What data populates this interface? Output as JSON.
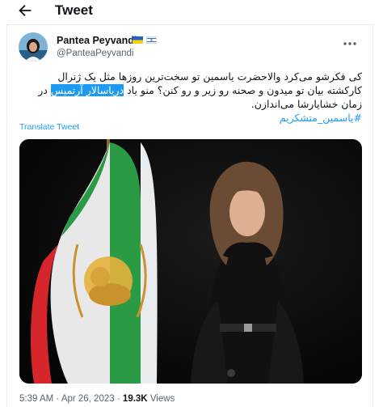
{
  "header": {
    "back_icon": "arrow-left-icon",
    "title": "Tweet"
  },
  "tweet": {
    "author": {
      "display_name": "Pantea Peyvandi",
      "handle": "@PanteaPeyvandi",
      "badges": [
        "flag-ukraine-icon",
        "flag-israel-icon"
      ]
    },
    "text": {
      "before_highlight": "کی فکرشو می‌کرد والاحضرت یاسمین تو سخت‌ترین روزها مثل یک ژنرال کارکشته بیان تو میدون و صحنه رو زیر و رو کنن؟ منو یاد",
      "highlight": "دریاسالار آرتمیس",
      "after_highlight": "در زمان خشایارشا می‌اندازن.",
      "hashtag": "#یاسمین_متشکریم"
    },
    "translate_label": "Translate Tweet",
    "meta": {
      "time": "5:39 AM",
      "sep1": "·",
      "date": "Apr 26, 2023",
      "sep2": "·",
      "views": "19.3K",
      "views_label": "Views"
    }
  },
  "colors": {
    "accent": "#1d9bf0",
    "text": "#0f1419",
    "muted": "#536471",
    "flag_green": "#2a9a45",
    "flag_red": "#d6262b"
  }
}
